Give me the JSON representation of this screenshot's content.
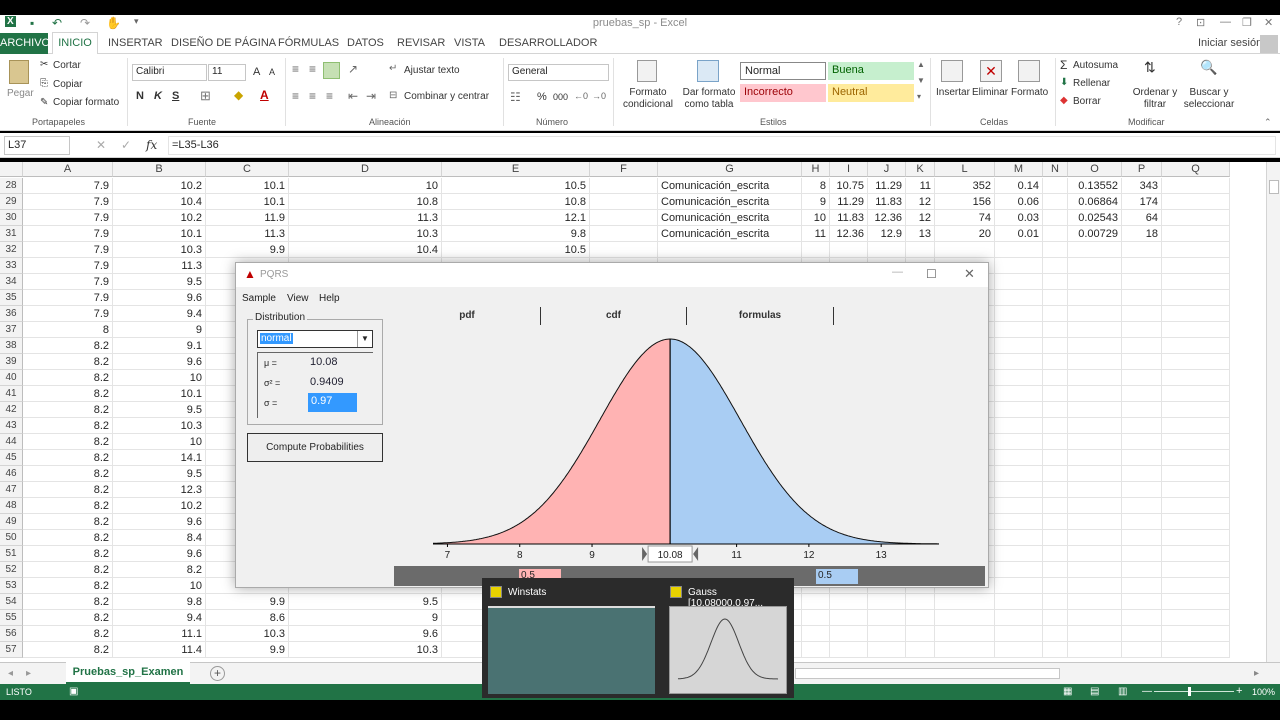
{
  "window": {
    "title": "pruebas_sp - Excel",
    "signin": "Iniciar sesión",
    "win_controls": [
      "?",
      "⊡",
      "—",
      "❐",
      "✕"
    ]
  },
  "menu": {
    "archivo": "ARCHIVO",
    "items": [
      "INICIO",
      "INSERTAR",
      "DISEÑO DE PÁGINA",
      "FÓRMULAS",
      "DATOS",
      "REVISAR",
      "VISTA",
      "DESARROLLADOR"
    ]
  },
  "ribbon": {
    "clipboard": {
      "paste": "Pegar",
      "cut": "Cortar",
      "copy": "Copiar",
      "format_painter": "Copiar formato",
      "label": "Portapapeles"
    },
    "font": {
      "name": "Calibri",
      "size": "11",
      "grow": "A",
      "shrink": "A",
      "bold": "N",
      "italic": "K",
      "underline": "S",
      "color_letter": "A",
      "label": "Fuente"
    },
    "alignment": {
      "wrap": "Ajustar texto",
      "merge": "Combinar y centrar",
      "label": "Alineación"
    },
    "number": {
      "format": "General",
      "percent": "%",
      "thousands": "000",
      "label": "Número"
    },
    "styles": {
      "conditional": "Formato condicional",
      "as_table": "Dar formato como tabla",
      "normal": "Normal",
      "good": "Buena",
      "bad": "Incorrecto",
      "neutral": "Neutral",
      "label": "Estilos"
    },
    "cells": {
      "insert": "Insertar",
      "delete": "Eliminar",
      "format": "Formato",
      "label": "Celdas"
    },
    "editing": {
      "autosum": "Autosuma",
      "fill": "Rellenar",
      "clear": "Borrar",
      "sort": "Ordenar y filtrar",
      "find": "Buscar y seleccionar",
      "label": "Modificar"
    }
  },
  "formula_bar": {
    "name_box": "L37",
    "fx": "fx",
    "formula": "=L35-L36"
  },
  "columns": [
    "A",
    "B",
    "C",
    "D",
    "E",
    "F",
    "G",
    "H",
    "I",
    "J",
    "K",
    "L",
    "M",
    "N",
    "O",
    "P",
    "Q"
  ],
  "rows": [
    {
      "n": "28",
      "A": "7.9",
      "B": "10.2",
      "C": "10.1",
      "D": "10",
      "E": "10.5",
      "G": "Comunicación_escrita",
      "H": "8",
      "I": "10.75",
      "J": "11.29",
      "K": "11",
      "L": "352",
      "M": "0.14",
      "O": "0.13552",
      "P": "343"
    },
    {
      "n": "29",
      "A": "7.9",
      "B": "10.4",
      "C": "10.1",
      "D": "10.8",
      "E": "10.8",
      "G": "Comunicación_escrita",
      "H": "9",
      "I": "11.29",
      "J": "11.83",
      "K": "12",
      "L": "156",
      "M": "0.06",
      "O": "0.06864",
      "P": "174"
    },
    {
      "n": "30",
      "A": "7.9",
      "B": "10.2",
      "C": "11.9",
      "D": "11.3",
      "E": "12.1",
      "G": "Comunicación_escrita",
      "H": "10",
      "I": "11.83",
      "J": "12.36",
      "K": "12",
      "L": "74",
      "M": "0.03",
      "O": "0.02543",
      "P": "64"
    },
    {
      "n": "31",
      "A": "7.9",
      "B": "10.1",
      "C": "11.3",
      "D": "10.3",
      "E": "9.8",
      "G": "Comunicación_escrita",
      "H": "11",
      "I": "12.36",
      "J": "12.9",
      "K": "13",
      "L": "20",
      "M": "0.01",
      "O": "0.00729",
      "P": "18"
    },
    {
      "n": "32",
      "A": "7.9",
      "B": "10.3",
      "C": "9.9",
      "D": "10.4",
      "E": "10.5"
    },
    {
      "n": "33",
      "A": "7.9",
      "B": "11.3"
    },
    {
      "n": "34",
      "A": "7.9",
      "B": "9.5"
    },
    {
      "n": "35",
      "A": "7.9",
      "B": "9.6"
    },
    {
      "n": "36",
      "A": "7.9",
      "B": "9.4"
    },
    {
      "n": "37",
      "A": "8",
      "B": "9"
    },
    {
      "n": "38",
      "A": "8.2",
      "B": "9.1"
    },
    {
      "n": "39",
      "A": "8.2",
      "B": "9.6"
    },
    {
      "n": "40",
      "A": "8.2",
      "B": "10"
    },
    {
      "n": "41",
      "A": "8.2",
      "B": "10.1"
    },
    {
      "n": "42",
      "A": "8.2",
      "B": "9.5"
    },
    {
      "n": "43",
      "A": "8.2",
      "B": "10.3"
    },
    {
      "n": "44",
      "A": "8.2",
      "B": "10"
    },
    {
      "n": "45",
      "A": "8.2",
      "B": "14.1"
    },
    {
      "n": "46",
      "A": "8.2",
      "B": "9.5"
    },
    {
      "n": "47",
      "A": "8.2",
      "B": "12.3"
    },
    {
      "n": "48",
      "A": "8.2",
      "B": "10.2"
    },
    {
      "n": "49",
      "A": "8.2",
      "B": "9.6"
    },
    {
      "n": "50",
      "A": "8.2",
      "B": "8.4"
    },
    {
      "n": "51",
      "A": "8.2",
      "B": "9.6"
    },
    {
      "n": "52",
      "A": "8.2",
      "B": "8.2"
    },
    {
      "n": "53",
      "A": "8.2",
      "B": "10"
    },
    {
      "n": "54",
      "A": "8.2",
      "B": "9.8",
      "C": "9.9",
      "D": "9.5"
    },
    {
      "n": "55",
      "A": "8.2",
      "B": "9.4",
      "C": "8.6",
      "D": "9"
    },
    {
      "n": "56",
      "A": "8.2",
      "B": "11.1",
      "C": "10.3",
      "D": "9.6"
    },
    {
      "n": "57",
      "A": "8.2",
      "B": "11.4",
      "C": "9.9",
      "D": "10.3"
    }
  ],
  "sheet": {
    "tab": "Pruebas_sp_Examen",
    "add": "+"
  },
  "status": {
    "ready": "LISTO",
    "zoom": "100%"
  },
  "pqrs": {
    "title": "PQRS",
    "menu": [
      "Sample",
      "View",
      "Help"
    ],
    "tabs": [
      "pdf",
      "cdf",
      "formulas"
    ],
    "distribution_label": "Distribution",
    "distribution": "normal",
    "params": [
      {
        "label": "μ =",
        "value": "10.08"
      },
      {
        "label": "σ² =",
        "value": "0.9409"
      },
      {
        "label": "σ =",
        "value": "0.97"
      }
    ],
    "compute": "Compute Probabilities",
    "left_prob": "0.5",
    "right_prob": "0.5",
    "marker": "10.08",
    "mu": 10.08,
    "sigma": 0.97,
    "x_min": 6.8,
    "x_max": 13.8,
    "ticks": [
      7,
      8,
      9,
      11,
      12,
      13
    ],
    "left_color": "#ffb3b3",
    "right_color": "#a9cdf3"
  },
  "taskbar_preview": {
    "items": [
      {
        "title": "Winstats"
      },
      {
        "title": "Gauss [10.08000,0.97..."
      }
    ]
  }
}
